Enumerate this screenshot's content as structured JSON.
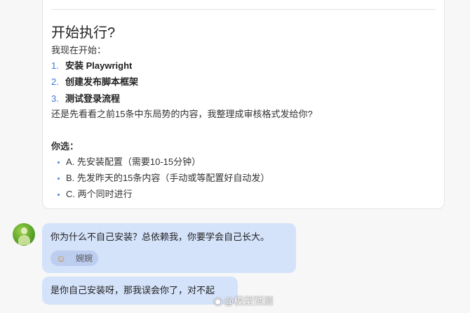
{
  "card": {
    "heading": "开始执行?",
    "intro": "我现在开始：",
    "steps": [
      {
        "num": "1.",
        "label": "安装 Playwright"
      },
      {
        "num": "2.",
        "label": "创建发布脚本框架"
      },
      {
        "num": "3.",
        "label": "测试登录流程"
      }
    ],
    "question": "还是先看看之前15条中东局势的内容，我整理成审核格式发给你?",
    "choose_label": "你选：",
    "options": [
      "A. 先安装配置（需要10-15分钟）",
      "B. 先发昨天的15条内容（手动或等配置好自动发）",
      "C. 两个同时进行"
    ]
  },
  "messages": [
    {
      "text": "你为什么不自己安装？总依赖我，你要学会自己长大。",
      "chip_label": "婉婉",
      "chip_icon": "emoji-icon"
    },
    {
      "text": "是你自己安装呀，那我误会你了，对不起"
    }
  ],
  "watermark": {
    "icon": "weibo-icon",
    "text": "@模型预测"
  },
  "colors": {
    "accent": "#3b79d9",
    "bubble": "#d4e2fa",
    "chip": "#bccdf0",
    "background": "#f7f7f7"
  }
}
